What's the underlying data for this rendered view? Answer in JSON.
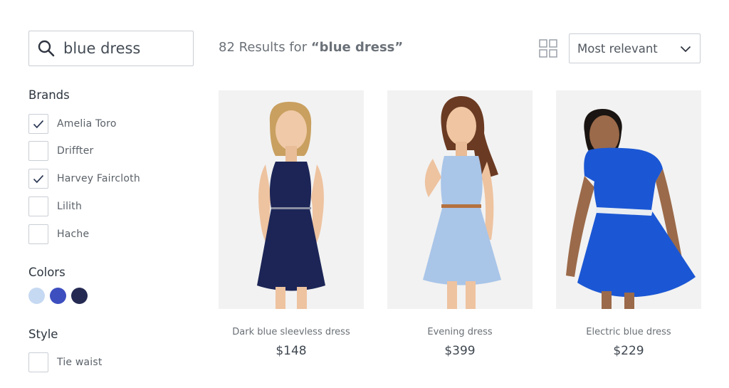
{
  "search": {
    "value": "blue dress",
    "icon": "search-icon"
  },
  "results": {
    "count_text": "82 Results for ",
    "query_display": "“blue dress”"
  },
  "sort": {
    "selected": "Most relevant",
    "icon": "chevron-down-icon"
  },
  "view_toggle": {
    "icon": "grid-view-icon"
  },
  "filters": {
    "brands": {
      "title": "Brands",
      "items": [
        {
          "label": "Amelia Toro",
          "checked": true
        },
        {
          "label": "Driffter",
          "checked": false
        },
        {
          "label": "Harvey Faircloth",
          "checked": true
        },
        {
          "label": "Lilith",
          "checked": false
        },
        {
          "label": "Hache",
          "checked": false
        }
      ]
    },
    "colors": {
      "title": "Colors",
      "swatches": [
        {
          "name": "light-blue",
          "hex": "#c6d9f2"
        },
        {
          "name": "blue",
          "hex": "#3d4fbf"
        },
        {
          "name": "navy",
          "hex": "#242a52"
        }
      ]
    },
    "style": {
      "title": "Style",
      "items": [
        {
          "label": "Tie waist",
          "checked": false
        }
      ]
    }
  },
  "products": [
    {
      "name": "Dark blue sleevless dress",
      "price": "$148",
      "dress_color": "#1c2556",
      "hair_color": "#c9a060"
    },
    {
      "name": "Evening dress",
      "price": "$399",
      "dress_color": "#a9c5e8",
      "hair_color": "#6b3a22"
    },
    {
      "name": "Electric blue dress",
      "price": "$229",
      "dress_color": "#1b57d4",
      "hair_color": "#1a1512"
    }
  ],
  "colors": {
    "border": "#c9ced4",
    "text": "#333d47",
    "check": "#2d3a55"
  }
}
